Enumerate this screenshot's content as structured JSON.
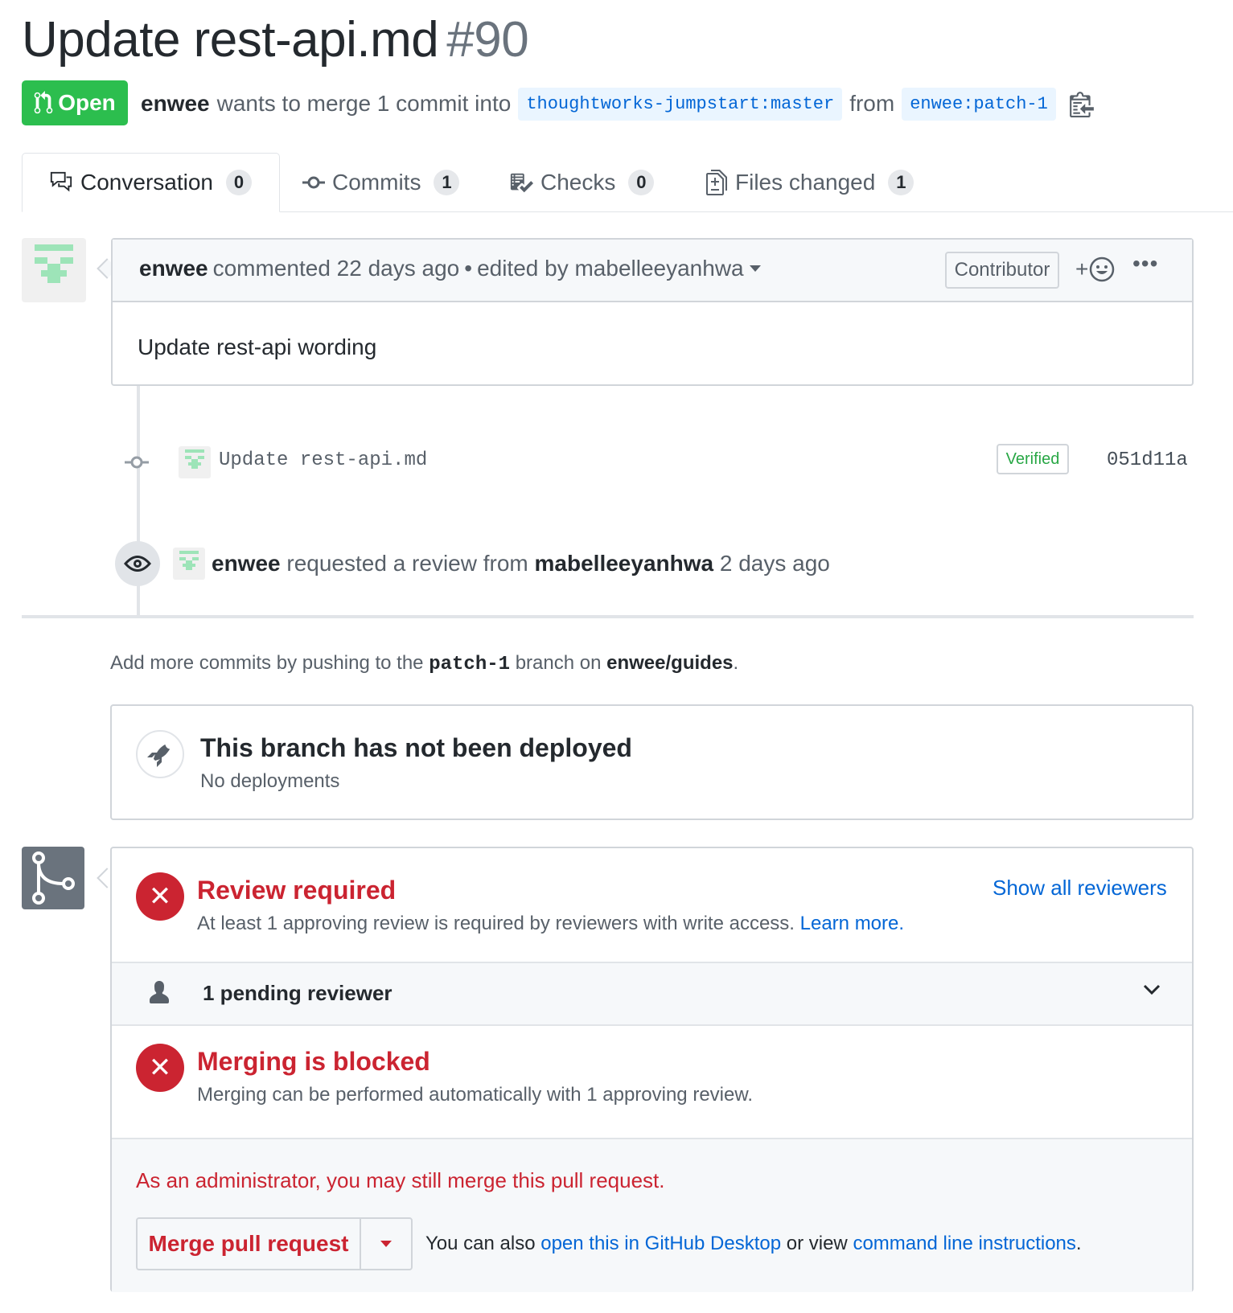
{
  "pr": {
    "title": "Update rest-api.md",
    "number": "#90",
    "state": "Open",
    "author": "enwee",
    "merge_text": "wants to merge 1 commit into",
    "base_branch": "thoughtworks-jumpstart:master",
    "from_text": "from",
    "head_branch": "enwee:patch-1"
  },
  "tabs": [
    {
      "label": "Conversation",
      "count": "0",
      "icon": "comment-discussion-icon"
    },
    {
      "label": "Commits",
      "count": "1",
      "icon": "git-commit-icon"
    },
    {
      "label": "Checks",
      "count": "0",
      "icon": "checklist-icon"
    },
    {
      "label": "Files changed",
      "count": "1",
      "icon": "diff-icon"
    }
  ],
  "comment": {
    "author": "enwee",
    "meta": "commented 22 days ago",
    "separator": "•",
    "edited": "edited by mabelleeyanhwa",
    "badge": "Contributor",
    "emoji_plus": "+",
    "more": "•••",
    "body": "Update rest-api wording"
  },
  "timeline": {
    "commit_message": "Update rest-api.md",
    "verified": "Verified",
    "sha": "051d11a",
    "review_actor": "enwee",
    "review_text": "requested a review from",
    "review_target": "mabelleeyanhwa",
    "review_time": "2 days ago"
  },
  "push_hint": {
    "prefix": "Add more commits by pushing to the",
    "branch": "patch-1",
    "middle": "branch on",
    "repo": "enwee/guides",
    "suffix": "."
  },
  "deployment": {
    "title": "This branch has not been deployed",
    "subtitle": "No deployments"
  },
  "merge": {
    "review_title": "Review required",
    "review_sub": "At least 1 approving review is required by reviewers with write access.",
    "learn_more": "Learn more.",
    "show_reviewers": "Show all reviewers",
    "pending": "1 pending reviewer",
    "blocked_title": "Merging is blocked",
    "blocked_sub": "Merging can be performed automatically with 1 approving review.",
    "admin_note": "As an administrator, you may still merge this pull request.",
    "merge_button": "Merge pull request",
    "alt_prefix": "You can also",
    "alt_desktop": "open this in GitHub Desktop",
    "alt_middle": "or view",
    "alt_cli": "command line instructions",
    "alt_suffix": "."
  },
  "colors": {
    "open_green": "#2cbe4e",
    "link_blue": "#0366d6",
    "error_red": "#cb2431",
    "identicon_green": "#9de4b8"
  }
}
